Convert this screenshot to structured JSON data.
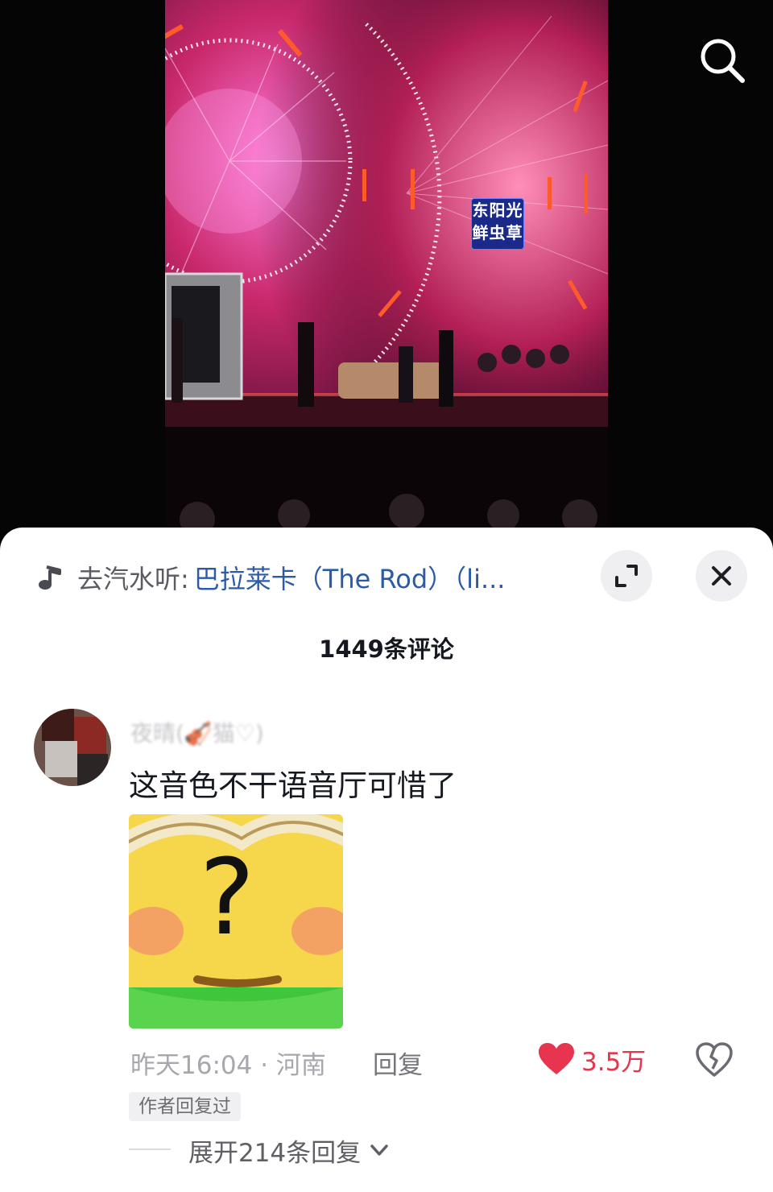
{
  "video": {
    "banner_line1": "东阳光",
    "banner_line2": "鲜虫草"
  },
  "icons": {
    "search": "search-icon",
    "music": "music-note-icon",
    "expand": "expand-icon",
    "close": "close-icon",
    "like": "heart-icon",
    "dislike": "broken-heart-icon",
    "chevron": "chevron-down-icon"
  },
  "music": {
    "prefix": "去汽水听:",
    "title": "巴拉莱卡（The Rod）（li..."
  },
  "comments_header": {
    "count_label": "1449条评论"
  },
  "comment": {
    "username": "夜晴(🎻猫♡)",
    "text": "这音色不干语音厅可惜了",
    "time_location": "昨天16:04 · 河南",
    "reply_label": "回复",
    "like_count": "3.5万",
    "author_badge": "作者回复过",
    "expand_label": "展开214条回复"
  },
  "colors": {
    "like": "#e7344f",
    "link": "#2b5aa8",
    "sheet_bg": "#ffffff"
  }
}
